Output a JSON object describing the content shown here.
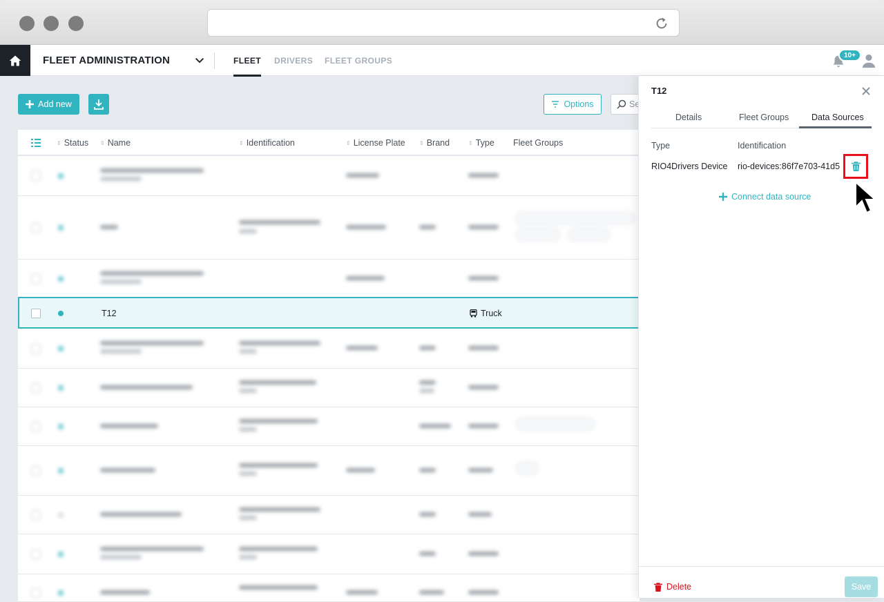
{
  "app": {
    "title": "FLEET ADMINISTRATION",
    "nav": [
      "FLEET",
      "DRIVERS",
      "FLEET GROUPS"
    ],
    "notifications_badge": "10+"
  },
  "toolbar": {
    "add_label": "Add new",
    "options_label": "Options",
    "search_placeholder": "Se"
  },
  "table": {
    "headers": [
      "Status",
      "Name",
      "Identification",
      "License Plate",
      "Brand",
      "Type",
      "Fleet Groups"
    ],
    "selected_row": {
      "name": "T12",
      "type": "Truck"
    }
  },
  "panel": {
    "title": "T12",
    "tabs": [
      "Details",
      "Fleet Groups",
      "Data Sources"
    ],
    "active_tab": "Data Sources",
    "columns": [
      "Type",
      "Identification"
    ],
    "data_source": {
      "type": "RIO4Drivers Device",
      "identification": "rio-devices:86f7e703-41d5"
    },
    "connect_label": "Connect data source",
    "delete_label": "Delete",
    "save_label": "Save"
  },
  "colors": {
    "accent": "#30b4c0",
    "danger": "#e8101b",
    "dark": "#1d2228"
  }
}
